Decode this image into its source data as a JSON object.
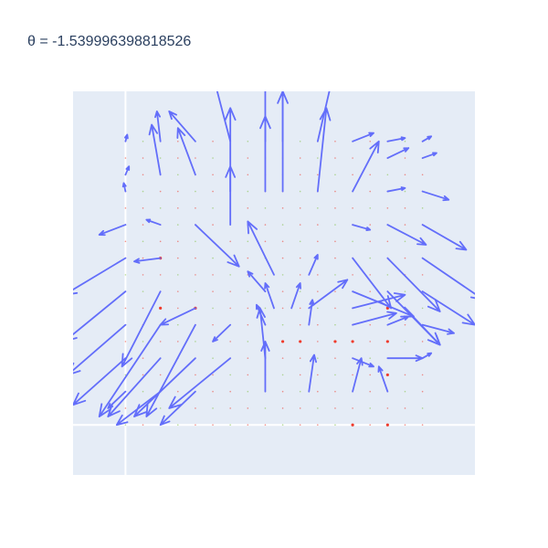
{
  "chart_data": {
    "type": "quiver",
    "title": "θ =  -1.539996398818526",
    "xlabel": "",
    "ylabel": "",
    "xlim": [
      -1.15,
      1.15
    ],
    "ylim": [
      -1.15,
      1.15
    ],
    "grid": true,
    "legend": "none",
    "colors": {
      "plot_bg": "#e5ecf6",
      "paper_bg": "#ffffff",
      "arrow": "#636efa",
      "point_red": "#ef3b2c",
      "point_green": "#7fbf3f",
      "zero_line": "#ffffff",
      "title": "#2a3f5f"
    },
    "grid_points": {
      "x": [
        -0.85,
        -0.75,
        -0.65,
        -0.55,
        -0.45,
        -0.35,
        -0.25,
        -0.15,
        -0.05,
        0.05,
        0.15,
        0.25,
        0.35,
        0.45,
        0.55,
        0.65,
        0.75,
        0.85
      ],
      "y": [
        -0.85,
        -0.75,
        -0.65,
        -0.55,
        -0.45,
        -0.35,
        -0.25,
        -0.15,
        -0.05,
        0.05,
        0.15,
        0.25,
        0.35,
        0.45,
        0.55,
        0.65,
        0.75,
        0.85
      ],
      "red": [
        [
          0.65,
          -0.35
        ],
        [
          0.65,
          -0.15
        ],
        [
          0.45,
          -0.35
        ],
        [
          0.65,
          -0.55
        ],
        [
          -0.65,
          -0.15
        ],
        [
          0.15,
          -0.35
        ],
        [
          0.35,
          -0.35
        ],
        [
          -0.45,
          -0.15
        ],
        [
          0.05,
          -0.35
        ],
        [
          -0.65,
          0.15
        ],
        [
          0.45,
          -0.85
        ],
        [
          0.65,
          -0.85
        ]
      ]
    },
    "arrows": [
      {
        "x": -0.25,
        "y": 0.85,
        "u": -0.1,
        "v": 0.4
      },
      {
        "x": -0.05,
        "y": 0.85,
        "u": 0.0,
        "v": 0.6
      },
      {
        "x": 0.05,
        "y": 0.85,
        "u": 0.0,
        "v": 0.6
      },
      {
        "x": 0.25,
        "y": 0.85,
        "u": 0.1,
        "v": 0.45
      },
      {
        "x": -0.45,
        "y": 0.85,
        "u": -0.15,
        "v": 0.18
      },
      {
        "x": 0.45,
        "y": 0.85,
        "u": 0.12,
        "v": 0.05
      },
      {
        "x": 0.65,
        "y": 0.85,
        "u": 0.1,
        "v": 0.02
      },
      {
        "x": 0.85,
        "y": 0.85,
        "u": 0.05,
        "v": 0.03
      },
      {
        "x": -0.85,
        "y": 0.85,
        "u": 0.01,
        "v": 0.04
      },
      {
        "x": -0.65,
        "y": 0.85,
        "u": -0.02,
        "v": 0.18
      },
      {
        "x": -0.65,
        "y": 0.65,
        "u": -0.05,
        "v": 0.3
      },
      {
        "x": -0.45,
        "y": 0.65,
        "u": -0.1,
        "v": 0.28
      },
      {
        "x": -0.25,
        "y": 0.55,
        "u": 0.0,
        "v": 0.5
      },
      {
        "x": -0.05,
        "y": 0.55,
        "u": 0.0,
        "v": 0.45
      },
      {
        "x": 0.05,
        "y": 0.55,
        "u": 0.0,
        "v": 0.6
      },
      {
        "x": 0.25,
        "y": 0.55,
        "u": 0.05,
        "v": 0.5
      },
      {
        "x": 0.45,
        "y": 0.55,
        "u": 0.15,
        "v": 0.3
      },
      {
        "x": 0.65,
        "y": 0.55,
        "u": 0.1,
        "v": 0.02
      },
      {
        "x": 0.65,
        "y": 0.75,
        "u": 0.12,
        "v": 0.06
      },
      {
        "x": 0.85,
        "y": 0.75,
        "u": 0.08,
        "v": 0.03
      },
      {
        "x": 0.85,
        "y": 0.55,
        "u": 0.15,
        "v": -0.05
      },
      {
        "x": -0.85,
        "y": 0.65,
        "u": 0.02,
        "v": 0.05
      },
      {
        "x": -0.85,
        "y": 0.55,
        "u": -0.01,
        "v": 0.05
      },
      {
        "x": -0.85,
        "y": 0.35,
        "u": -0.15,
        "v": -0.06
      },
      {
        "x": -0.65,
        "y": 0.35,
        "u": -0.08,
        "v": 0.03
      },
      {
        "x": -0.45,
        "y": 0.35,
        "u": 0.25,
        "v": -0.25
      },
      {
        "x": -0.25,
        "y": 0.35,
        "u": 0.0,
        "v": 0.35
      },
      {
        "x": 0.0,
        "y": 0.05,
        "u": -0.15,
        "v": 0.32
      },
      {
        "x": 0.2,
        "y": 0.05,
        "u": 0.05,
        "v": 0.12
      },
      {
        "x": 0.45,
        "y": 0.35,
        "u": 0.1,
        "v": -0.03
      },
      {
        "x": 0.65,
        "y": 0.35,
        "u": 0.22,
        "v": -0.12
      },
      {
        "x": 0.85,
        "y": 0.35,
        "u": 0.25,
        "v": -0.15
      },
      {
        "x": -0.85,
        "y": 0.15,
        "u": -0.35,
        "v": -0.22
      },
      {
        "x": -0.65,
        "y": 0.15,
        "u": -0.15,
        "v": -0.02
      },
      {
        "x": -0.05,
        "y": -0.05,
        "u": -0.1,
        "v": 0.12
      },
      {
        "x": 0.45,
        "y": 0.15,
        "u": 0.22,
        "v": -0.3
      },
      {
        "x": 0.65,
        "y": 0.15,
        "u": 0.3,
        "v": -0.32
      },
      {
        "x": 0.85,
        "y": 0.15,
        "u": 0.35,
        "v": -0.25
      },
      {
        "x": -0.85,
        "y": -0.05,
        "u": -0.35,
        "v": -0.3
      },
      {
        "x": -0.65,
        "y": -0.05,
        "u": -0.22,
        "v": -0.45
      },
      {
        "x": -0.45,
        "y": -0.15,
        "u": -0.2,
        "v": -0.1
      },
      {
        "x": 0.0,
        "y": -0.15,
        "u": -0.05,
        "v": 0.15
      },
      {
        "x": 0.1,
        "y": -0.15,
        "u": 0.05,
        "v": 0.15
      },
      {
        "x": 0.2,
        "y": -0.15,
        "u": 0.22,
        "v": 0.17
      },
      {
        "x": 0.45,
        "y": -0.15,
        "u": 0.3,
        "v": 0.08
      },
      {
        "x": 0.45,
        "y": -0.05,
        "u": 0.35,
        "v": -0.15
      },
      {
        "x": 0.65,
        "y": -0.05,
        "u": 0.3,
        "v": -0.32
      },
      {
        "x": 0.75,
        "y": -0.15,
        "u": 0.2,
        "v": -0.22
      },
      {
        "x": 0.85,
        "y": -0.05,
        "u": 0.3,
        "v": -0.2
      },
      {
        "x": -0.85,
        "y": -0.25,
        "u": -0.33,
        "v": -0.3
      },
      {
        "x": -0.65,
        "y": -0.25,
        "u": -0.35,
        "v": -0.55
      },
      {
        "x": -0.45,
        "y": -0.25,
        "u": -0.28,
        "v": -0.55
      },
      {
        "x": -0.25,
        "y": -0.25,
        "u": -0.1,
        "v": -0.1
      },
      {
        "x": -0.05,
        "y": -0.25,
        "u": -0.05,
        "v": 0.12
      },
      {
        "x": 0.2,
        "y": -0.25,
        "u": 0.02,
        "v": 0.15
      },
      {
        "x": 0.45,
        "y": -0.25,
        "u": 0.25,
        "v": 0.07
      },
      {
        "x": 0.65,
        "y": -0.25,
        "u": 0.12,
        "v": 0.05
      },
      {
        "x": 0.65,
        "y": -0.45,
        "u": 0.2,
        "v": 0.0
      },
      {
        "x": 0.85,
        "y": -0.25,
        "u": 0.18,
        "v": -0.05
      },
      {
        "x": -0.85,
        "y": -0.45,
        "u": -0.3,
        "v": -0.28
      },
      {
        "x": -0.65,
        "y": -0.45,
        "u": -0.3,
        "v": -0.35
      },
      {
        "x": -0.45,
        "y": -0.45,
        "u": -0.35,
        "v": -0.35
      },
      {
        "x": -0.25,
        "y": -0.45,
        "u": -0.35,
        "v": -0.3
      },
      {
        "x": -0.05,
        "y": -0.45,
        "u": -0.03,
        "v": 0.3
      },
      {
        "x": -0.05,
        "y": -0.65,
        "u": 0.0,
        "v": 0.3
      },
      {
        "x": 0.2,
        "y": -0.65,
        "u": 0.03,
        "v": 0.22
      },
      {
        "x": 0.45,
        "y": -0.65,
        "u": 0.05,
        "v": 0.2
      },
      {
        "x": 0.45,
        "y": -0.45,
        "u": 0.12,
        "v": -0.05
      },
      {
        "x": 0.65,
        "y": -0.65,
        "u": -0.05,
        "v": 0.15
      },
      {
        "x": 0.85,
        "y": -0.45,
        "u": 0.05,
        "v": 0.03
      },
      {
        "x": -0.65,
        "y": -0.65,
        "u": -0.25,
        "v": -0.2
      },
      {
        "x": -0.45,
        "y": -0.65,
        "u": -0.2,
        "v": -0.2
      },
      {
        "x": -0.85,
        "y": -0.65,
        "u": -0.1,
        "v": -0.1
      }
    ]
  }
}
